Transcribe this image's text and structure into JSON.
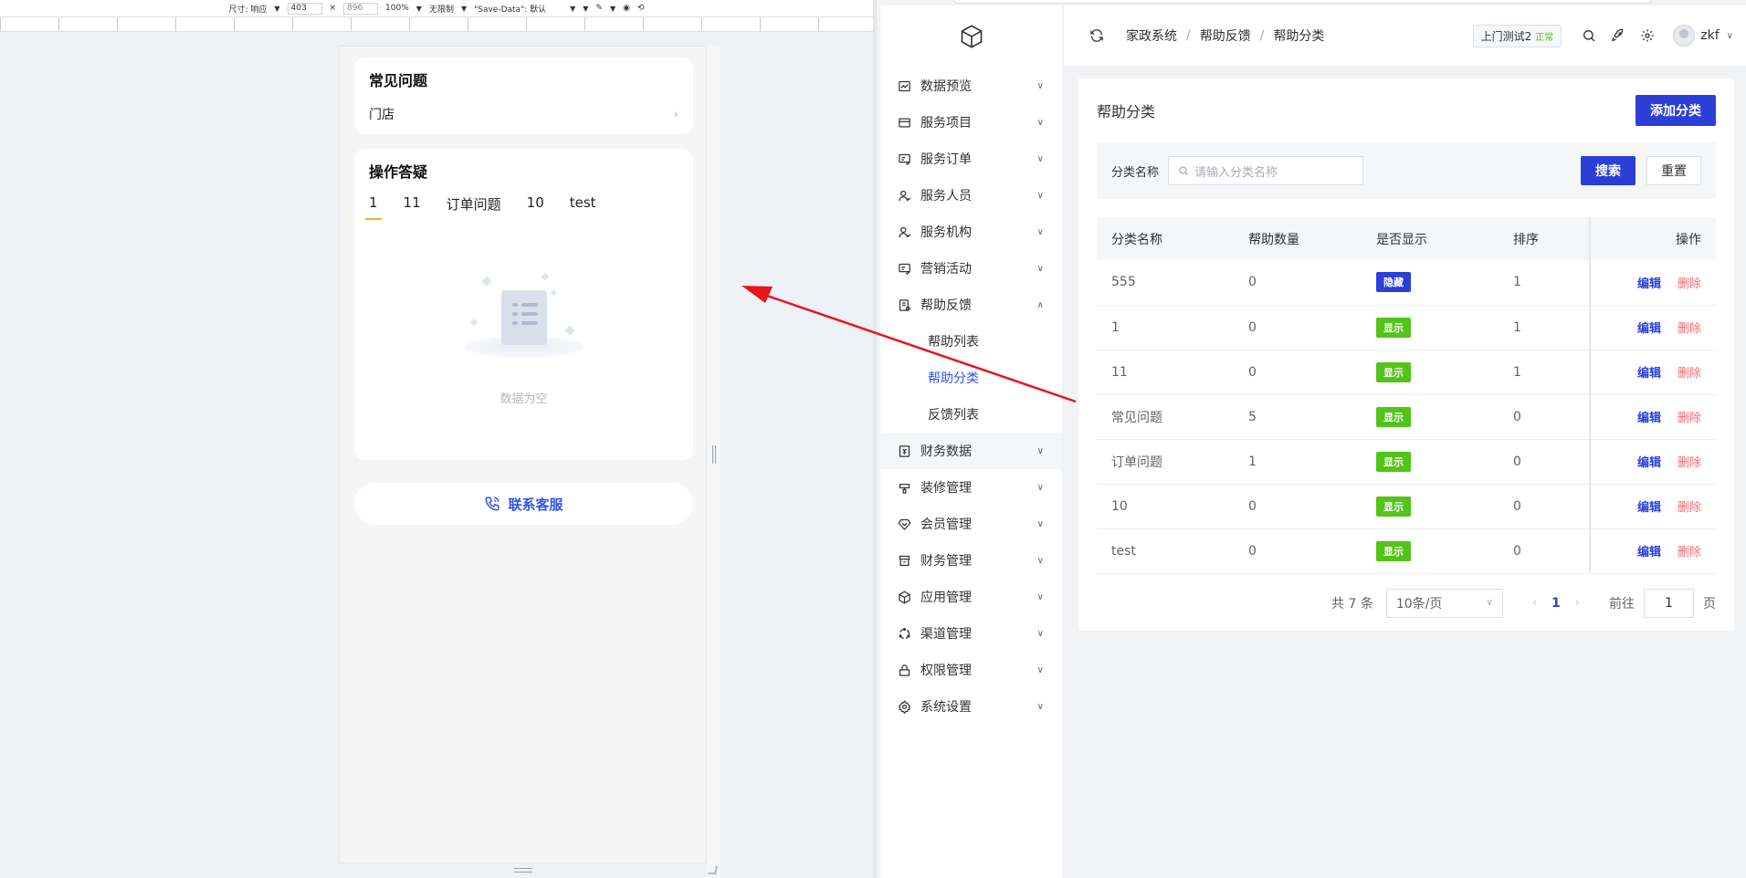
{
  "devtools": {
    "size_label": "尺寸: 响应",
    "width": "403",
    "times": "×",
    "height": "896",
    "zoom": "100%",
    "throttle": "无限制",
    "save_data": "\"Save-Data\": 默认"
  },
  "mobile": {
    "faq_title": "常见问题",
    "faq_item": "门店",
    "ops_title": "操作答疑",
    "tabs": [
      "1",
      "11",
      "订单问题",
      "10",
      "test"
    ],
    "empty_text": "数据为空",
    "contact_label": "联系客服"
  },
  "sidebar": {
    "items": [
      {
        "label": "数据预览",
        "icon": "chart-icon"
      },
      {
        "label": "服务项目",
        "icon": "card-icon"
      },
      {
        "label": "服务订单",
        "icon": "order-icon"
      },
      {
        "label": "服务人员",
        "icon": "user-icon"
      },
      {
        "label": "服务机构",
        "icon": "user-icon"
      },
      {
        "label": "营销活动",
        "icon": "order-icon"
      },
      {
        "label": "帮助反馈",
        "icon": "doc-icon"
      },
      {
        "label": "财务数据",
        "icon": "wallet-icon"
      },
      {
        "label": "装修管理",
        "icon": "brush-icon"
      },
      {
        "label": "会员管理",
        "icon": "diamond-icon"
      },
      {
        "label": "财务管理",
        "icon": "shop-icon"
      },
      {
        "label": "应用管理",
        "icon": "cube-icon"
      },
      {
        "label": "渠道管理",
        "icon": "cycle-icon"
      },
      {
        "label": "权限管理",
        "icon": "lock-icon"
      },
      {
        "label": "系统设置",
        "icon": "gear-icon"
      }
    ],
    "sub_items": [
      "帮助列表",
      "帮助分类",
      "反馈列表"
    ]
  },
  "header": {
    "breadcrumb": [
      "家政系统",
      "帮助反馈",
      "帮助分类"
    ],
    "shop_name": "上门测试2",
    "shop_status": "正常",
    "username": "zkf"
  },
  "page": {
    "title": "帮助分类",
    "add_button": "添加分类",
    "filter_label": "分类名称",
    "search_placeholder": "请输入分类名称",
    "search_button": "搜索",
    "reset_button": "重置"
  },
  "table": {
    "columns": [
      "分类名称",
      "帮助数量",
      "是否显示",
      "排序",
      "操作"
    ],
    "rows": [
      {
        "name": "555",
        "count": "0",
        "visible": "隐藏",
        "sort": "1"
      },
      {
        "name": "1",
        "count": "0",
        "visible": "显示",
        "sort": "1"
      },
      {
        "name": "11",
        "count": "0",
        "visible": "显示",
        "sort": "1"
      },
      {
        "name": "常见问题",
        "count": "5",
        "visible": "显示",
        "sort": "0"
      },
      {
        "name": "订单问题",
        "count": "1",
        "visible": "显示",
        "sort": "0"
      },
      {
        "name": "10",
        "count": "0",
        "visible": "显示",
        "sort": "0"
      },
      {
        "name": "test",
        "count": "0",
        "visible": "显示",
        "sort": "0"
      }
    ],
    "edit_label": "编辑",
    "delete_label": "删除"
  },
  "pagination": {
    "total": "共 7 条",
    "page_size": "10条/页",
    "current_page": "1",
    "goto_label": "前往",
    "goto_value": "1",
    "page_unit": "页"
  },
  "colors": {
    "primary": "#2b3fd8",
    "success": "#52c41a",
    "danger": "#f56c6c",
    "annotation": "#e8141c"
  }
}
